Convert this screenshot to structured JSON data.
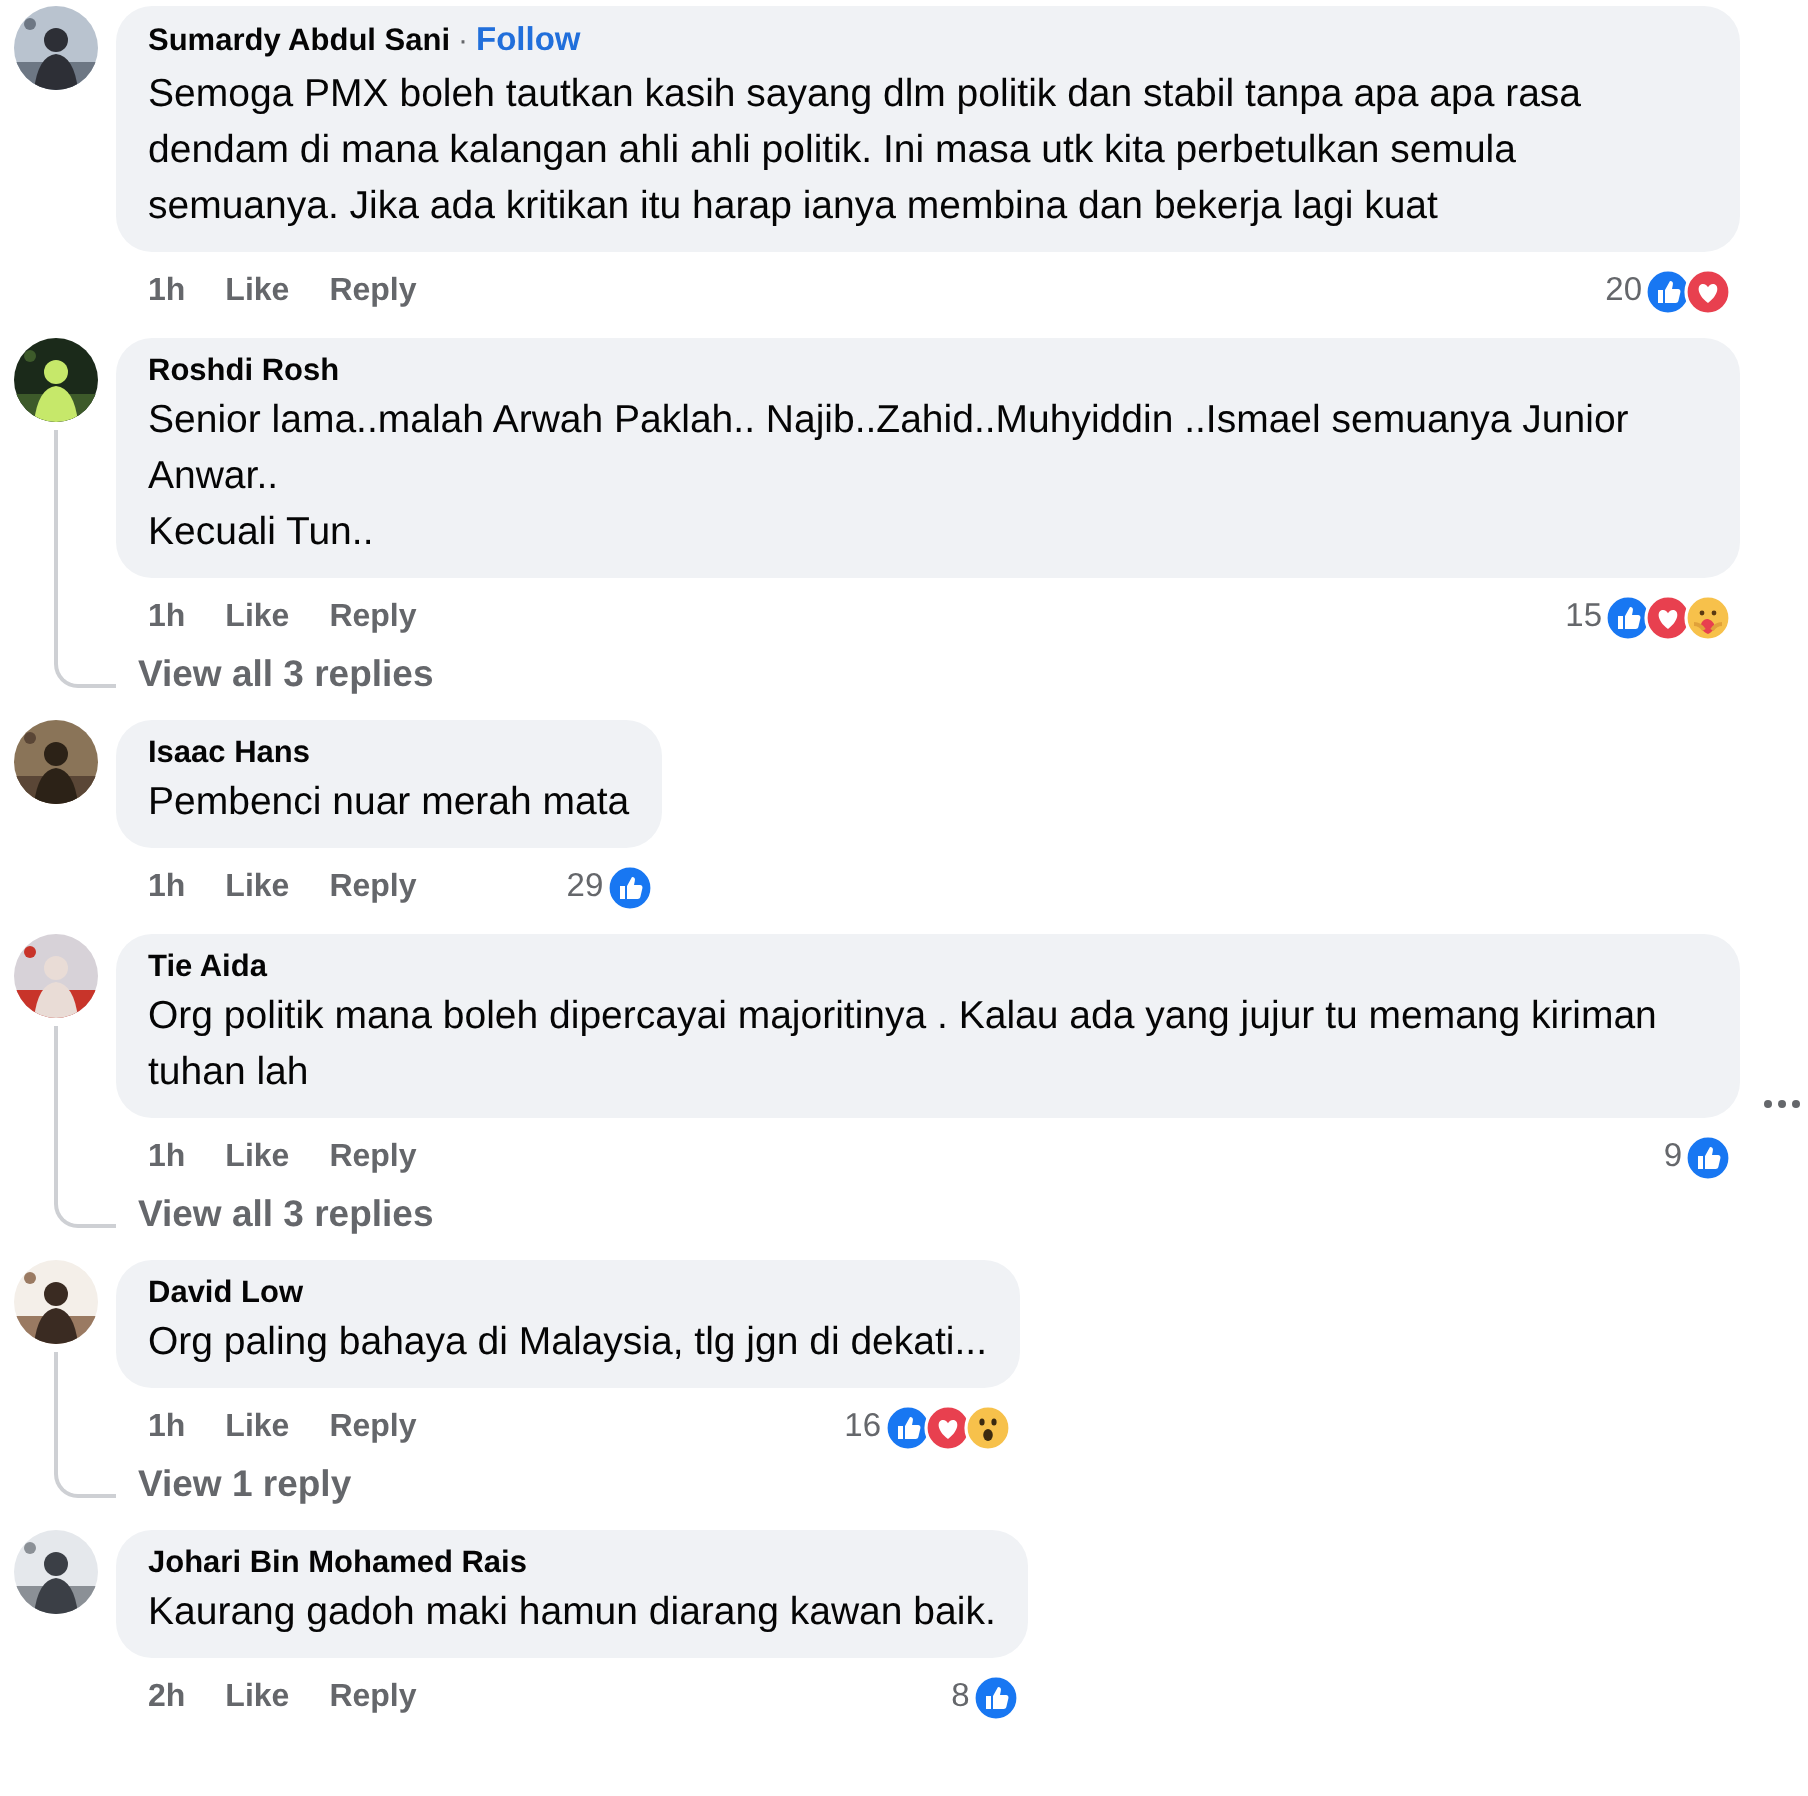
{
  "comments": [
    {
      "author": "Sumardy Abdul Sani",
      "separator": "·",
      "follow": "Follow",
      "text": "Semoga PMX boleh tautkan kasih sayang dlm politik dan stabil tanpa apa apa rasa dendam di mana kalangan ahli ahli politik. Ini masa utk kita perbetulkan semula semuanya. Jika ada kritikan itu harap ianya membina dan bekerja lagi kuat",
      "time": "1h",
      "like": "Like",
      "reply": "Reply",
      "reaction_count": "20",
      "reactions": [
        {
          "kind": "like"
        },
        {
          "kind": "love"
        }
      ],
      "more_menu": false
    },
    {
      "author": "Roshdi Rosh",
      "text": "Senior lama..malah Arwah Paklah.. Najib..Zahid..Muhyiddin ..Ismael semuanya Junior Anwar..\nKecuali Tun..",
      "time": "1h",
      "like": "Like",
      "reply": "Reply",
      "reaction_count": "15",
      "reactions": [
        {
          "kind": "like"
        },
        {
          "kind": "love"
        },
        {
          "kind": "care"
        }
      ],
      "view_replies": "View all 3 replies",
      "more_menu": false
    },
    {
      "author": "Isaac Hans",
      "text": "Pembenci nuar merah mata",
      "time": "1h",
      "like": "Like",
      "reply": "Reply",
      "reaction_count": "29",
      "reactions": [
        {
          "kind": "like"
        }
      ],
      "more_menu": false
    },
    {
      "author": "Tie Aida",
      "text": "Org politik mana boleh dipercayai majoritinya . Kalau ada yang jujur tu memang kiriman tuhan lah",
      "time": "1h",
      "like": "Like",
      "reply": "Reply",
      "reaction_count": "9",
      "reactions": [
        {
          "kind": "like"
        }
      ],
      "view_replies": "View all 3 replies",
      "more_menu": true
    },
    {
      "author": "David Low",
      "text": "Org paling bahaya di Malaysia, tlg jgn di dekati...",
      "time": "1h",
      "like": "Like",
      "reply": "Reply",
      "reaction_count": "16",
      "reactions": [
        {
          "kind": "like"
        },
        {
          "kind": "love"
        },
        {
          "kind": "wow"
        }
      ],
      "view_replies": "View 1 reply",
      "more_menu": false
    },
    {
      "author": "Johari Bin Mohamed Rais",
      "text": "Kaurang gadoh maki hamun diarang kawan baik.",
      "time": "2h",
      "like": "Like",
      "reply": "Reply",
      "reaction_count": "8",
      "reactions": [
        {
          "kind": "like"
        }
      ],
      "more_menu": false
    }
  ]
}
